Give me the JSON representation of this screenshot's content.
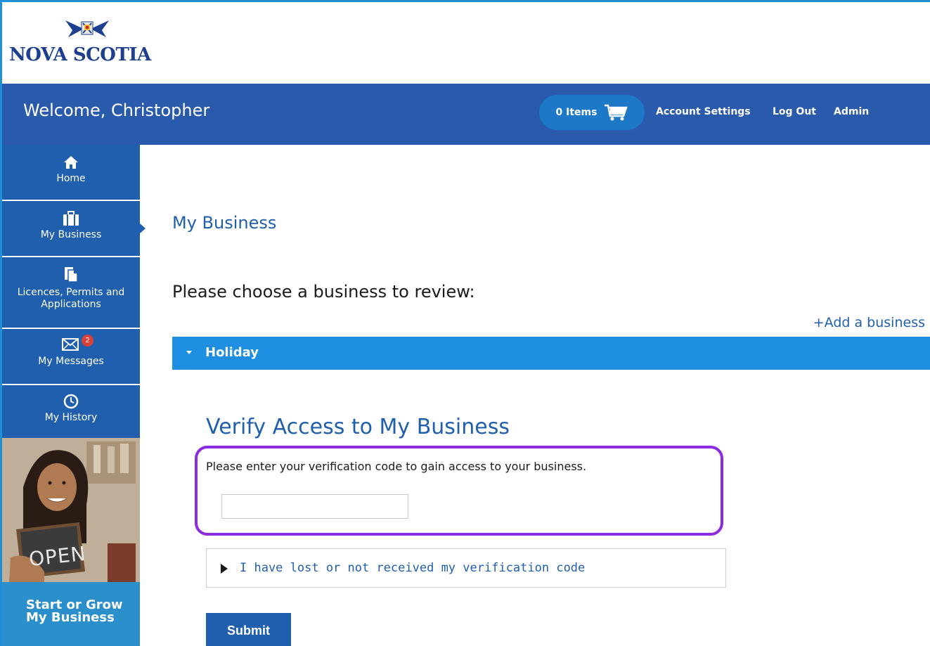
{
  "logo": {
    "text": "NOVA SCOTIA"
  },
  "header": {
    "welcome": "Welcome, Christopher",
    "cart_label": "0 Items",
    "account_settings": "Account Settings",
    "log_out": "Log Out",
    "admin": "Admin"
  },
  "sidebar": {
    "items": [
      {
        "label": "Home",
        "icon": "home-icon"
      },
      {
        "label": "My Business",
        "icon": "briefcase-icon",
        "active": true
      },
      {
        "label": "Licences, Permits and Applications",
        "icon": "documents-icon"
      },
      {
        "label": "My Messages",
        "icon": "envelope-icon",
        "badge": "2"
      },
      {
        "label": "My History",
        "icon": "clock-icon"
      }
    ],
    "promo_sign": "OPEN",
    "promo_cta": "Start or Grow My Business"
  },
  "main": {
    "page_title": "My Business",
    "choose_prompt": "Please choose a business to review:",
    "add_business": "+Add a business",
    "accordion": {
      "business_name": "Holiday",
      "verify_title": "Verify Access to My Business",
      "instruction": "Please enter your verification code to gain access to your business.",
      "code_value": "",
      "lost_code": "I have lost or not received my verification code",
      "submit": "Submit"
    }
  },
  "colors": {
    "header_bg": "#2a5aac",
    "accordion_bg": "#1e8ee0",
    "link": "#1f5fae",
    "highlight": "#8b2be2"
  }
}
